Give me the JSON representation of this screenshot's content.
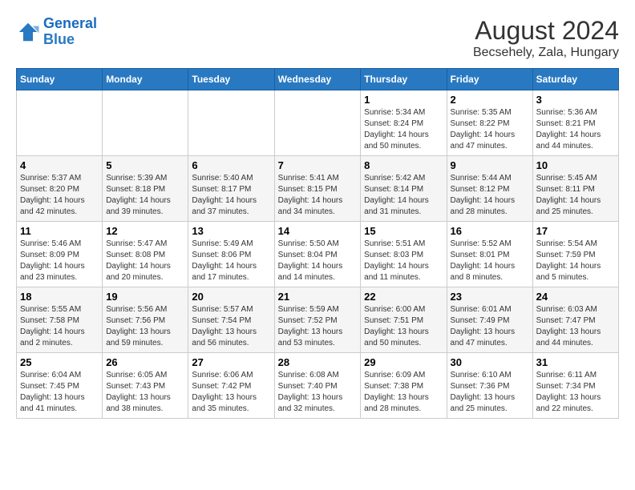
{
  "header": {
    "logo_line1": "General",
    "logo_line2": "Blue",
    "title": "August 2024",
    "subtitle": "Becsehely, Zala, Hungary"
  },
  "days_of_week": [
    "Sunday",
    "Monday",
    "Tuesday",
    "Wednesday",
    "Thursday",
    "Friday",
    "Saturday"
  ],
  "weeks": [
    [
      {
        "day": "",
        "info": ""
      },
      {
        "day": "",
        "info": ""
      },
      {
        "day": "",
        "info": ""
      },
      {
        "day": "",
        "info": ""
      },
      {
        "day": "1",
        "info": "Sunrise: 5:34 AM\nSunset: 8:24 PM\nDaylight: 14 hours and 50 minutes."
      },
      {
        "day": "2",
        "info": "Sunrise: 5:35 AM\nSunset: 8:22 PM\nDaylight: 14 hours and 47 minutes."
      },
      {
        "day": "3",
        "info": "Sunrise: 5:36 AM\nSunset: 8:21 PM\nDaylight: 14 hours and 44 minutes."
      }
    ],
    [
      {
        "day": "4",
        "info": "Sunrise: 5:37 AM\nSunset: 8:20 PM\nDaylight: 14 hours and 42 minutes."
      },
      {
        "day": "5",
        "info": "Sunrise: 5:39 AM\nSunset: 8:18 PM\nDaylight: 14 hours and 39 minutes."
      },
      {
        "day": "6",
        "info": "Sunrise: 5:40 AM\nSunset: 8:17 PM\nDaylight: 14 hours and 37 minutes."
      },
      {
        "day": "7",
        "info": "Sunrise: 5:41 AM\nSunset: 8:15 PM\nDaylight: 14 hours and 34 minutes."
      },
      {
        "day": "8",
        "info": "Sunrise: 5:42 AM\nSunset: 8:14 PM\nDaylight: 14 hours and 31 minutes."
      },
      {
        "day": "9",
        "info": "Sunrise: 5:44 AM\nSunset: 8:12 PM\nDaylight: 14 hours and 28 minutes."
      },
      {
        "day": "10",
        "info": "Sunrise: 5:45 AM\nSunset: 8:11 PM\nDaylight: 14 hours and 25 minutes."
      }
    ],
    [
      {
        "day": "11",
        "info": "Sunrise: 5:46 AM\nSunset: 8:09 PM\nDaylight: 14 hours and 23 minutes."
      },
      {
        "day": "12",
        "info": "Sunrise: 5:47 AM\nSunset: 8:08 PM\nDaylight: 14 hours and 20 minutes."
      },
      {
        "day": "13",
        "info": "Sunrise: 5:49 AM\nSunset: 8:06 PM\nDaylight: 14 hours and 17 minutes."
      },
      {
        "day": "14",
        "info": "Sunrise: 5:50 AM\nSunset: 8:04 PM\nDaylight: 14 hours and 14 minutes."
      },
      {
        "day": "15",
        "info": "Sunrise: 5:51 AM\nSunset: 8:03 PM\nDaylight: 14 hours and 11 minutes."
      },
      {
        "day": "16",
        "info": "Sunrise: 5:52 AM\nSunset: 8:01 PM\nDaylight: 14 hours and 8 minutes."
      },
      {
        "day": "17",
        "info": "Sunrise: 5:54 AM\nSunset: 7:59 PM\nDaylight: 14 hours and 5 minutes."
      }
    ],
    [
      {
        "day": "18",
        "info": "Sunrise: 5:55 AM\nSunset: 7:58 PM\nDaylight: 14 hours and 2 minutes."
      },
      {
        "day": "19",
        "info": "Sunrise: 5:56 AM\nSunset: 7:56 PM\nDaylight: 13 hours and 59 minutes."
      },
      {
        "day": "20",
        "info": "Sunrise: 5:57 AM\nSunset: 7:54 PM\nDaylight: 13 hours and 56 minutes."
      },
      {
        "day": "21",
        "info": "Sunrise: 5:59 AM\nSunset: 7:52 PM\nDaylight: 13 hours and 53 minutes."
      },
      {
        "day": "22",
        "info": "Sunrise: 6:00 AM\nSunset: 7:51 PM\nDaylight: 13 hours and 50 minutes."
      },
      {
        "day": "23",
        "info": "Sunrise: 6:01 AM\nSunset: 7:49 PM\nDaylight: 13 hours and 47 minutes."
      },
      {
        "day": "24",
        "info": "Sunrise: 6:03 AM\nSunset: 7:47 PM\nDaylight: 13 hours and 44 minutes."
      }
    ],
    [
      {
        "day": "25",
        "info": "Sunrise: 6:04 AM\nSunset: 7:45 PM\nDaylight: 13 hours and 41 minutes."
      },
      {
        "day": "26",
        "info": "Sunrise: 6:05 AM\nSunset: 7:43 PM\nDaylight: 13 hours and 38 minutes."
      },
      {
        "day": "27",
        "info": "Sunrise: 6:06 AM\nSunset: 7:42 PM\nDaylight: 13 hours and 35 minutes."
      },
      {
        "day": "28",
        "info": "Sunrise: 6:08 AM\nSunset: 7:40 PM\nDaylight: 13 hours and 32 minutes."
      },
      {
        "day": "29",
        "info": "Sunrise: 6:09 AM\nSunset: 7:38 PM\nDaylight: 13 hours and 28 minutes."
      },
      {
        "day": "30",
        "info": "Sunrise: 6:10 AM\nSunset: 7:36 PM\nDaylight: 13 hours and 25 minutes."
      },
      {
        "day": "31",
        "info": "Sunrise: 6:11 AM\nSunset: 7:34 PM\nDaylight: 13 hours and 22 minutes."
      }
    ]
  ]
}
